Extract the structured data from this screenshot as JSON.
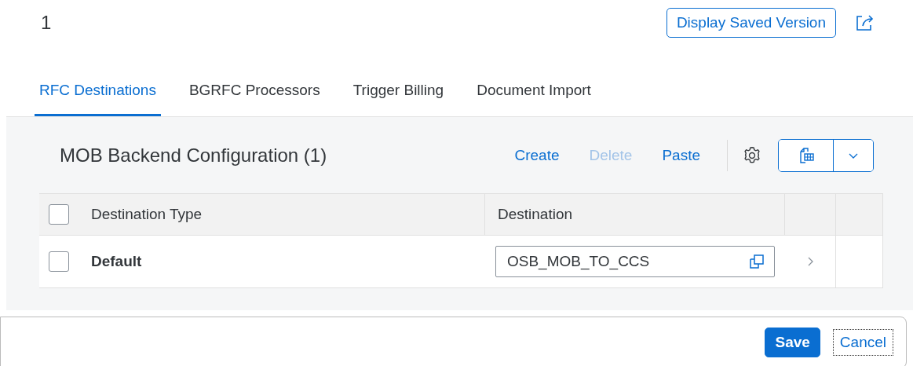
{
  "header": {
    "title": "1",
    "display_button": "Display Saved Version"
  },
  "tabs": [
    {
      "label": "RFC Destinations",
      "selected": true
    },
    {
      "label": "BGRFC Processors",
      "selected": false
    },
    {
      "label": "Trigger Billing",
      "selected": false
    },
    {
      "label": "Document Import",
      "selected": false
    }
  ],
  "table": {
    "title": "MOB Backend Configuration (1)",
    "actions": [
      {
        "label": "Create",
        "disabled": false
      },
      {
        "label": "Delete",
        "disabled": true
      },
      {
        "label": "Paste",
        "disabled": false
      }
    ],
    "select_all": {
      "checked": false
    },
    "columns": [
      "Destination Type",
      "Destination"
    ],
    "rows": [
      {
        "checked": false,
        "type": "Default",
        "destination": "OSB_MOB_TO_CCS"
      }
    ]
  },
  "footer": {
    "buttons": [
      {
        "label": "Save",
        "kind": "primary"
      },
      {
        "label": "Cancel",
        "kind": "secondary"
      }
    ]
  }
}
